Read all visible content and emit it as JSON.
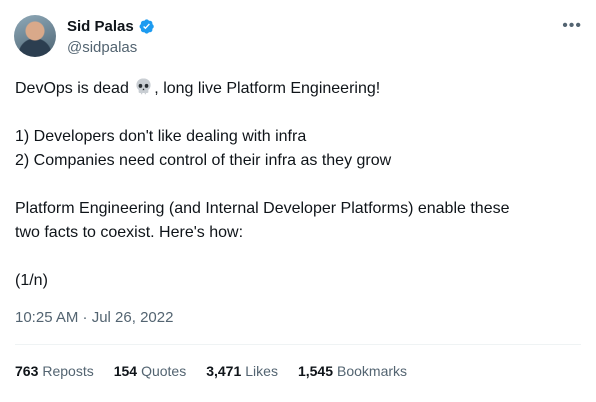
{
  "author": {
    "display_name": "Sid Palas",
    "handle": "@sidpalas",
    "verified": true
  },
  "menu_icon": "more-horizontal-icon",
  "tweet": {
    "line1_before": "DevOps is dead",
    "line1_emoji": "skull-emoji",
    "line1_after": ", long live Platform Engineering!",
    "point1": "1) Developers don't like dealing with infra",
    "point2": "2) Companies need control of their infra as they grow",
    "para_line1": "Platform Engineering (and Internal Developer Platforms) enable these",
    "para_line2": "two facts to coexist. Here's how:",
    "thread_marker": "(1/n)"
  },
  "timestamp": "10:25 AM · Jul 26, 2022",
  "stats": [
    {
      "value": "763",
      "label": "Reposts"
    },
    {
      "value": "154",
      "label": "Quotes"
    },
    {
      "value": "3,471",
      "label": "Likes"
    },
    {
      "value": "1,545",
      "label": "Bookmarks"
    }
  ],
  "colors": {
    "text": "#0f1419",
    "secondary": "#536471",
    "verified": "#1d9bf0",
    "divider": "#eff3f4"
  }
}
